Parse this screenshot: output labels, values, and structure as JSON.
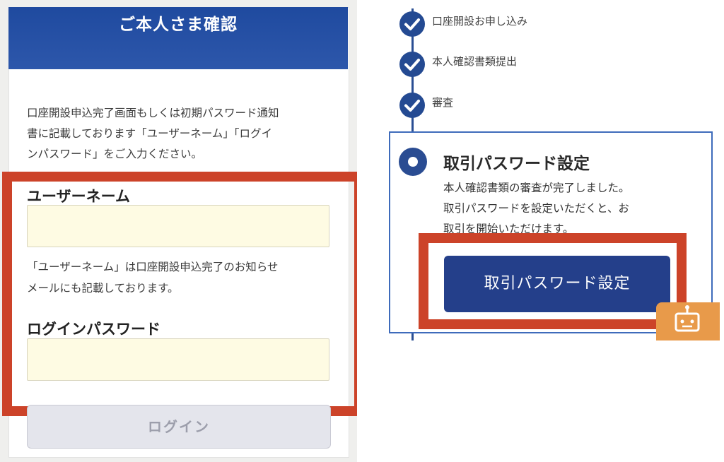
{
  "left": {
    "header_title": "ご本人さま確認",
    "intro_lines": [
      "口座開設申込完了画面もしくは初期パスワード通知",
      "書に記載しております「ユーザーネーム」「ログイ",
      "ンパスワード」をご入力ください。"
    ],
    "username_label": "ユーザーネーム",
    "username_value": "",
    "note_lines": [
      "「ユーザーネーム」は口座開設申込完了のお知らせ",
      "メールにも記載しております。"
    ],
    "password_label": "ログインパスワード",
    "password_value": "",
    "login_button": "ログイン"
  },
  "right": {
    "steps": [
      {
        "label": "口座開設お申し込み",
        "status": "done"
      },
      {
        "label": "本人確認書類提出",
        "status": "done"
      },
      {
        "label": "審査",
        "status": "done"
      }
    ],
    "current_step": {
      "title": "取引パスワード設定",
      "desc_lines": [
        "本人確認書類の審査が完了しました。",
        "取引パスワードを設定いただくと、お",
        "取引を開始いただけます。"
      ],
      "button_label": "取引パスワード設定"
    },
    "float_icon": "chat-support-icon"
  },
  "colors": {
    "header_blue": "#1f4a9f",
    "highlight_red": "#cc4329",
    "button_navy": "#243f8a",
    "input_yellow": "#fefbe3",
    "icon_orange": "#e89a4a"
  }
}
